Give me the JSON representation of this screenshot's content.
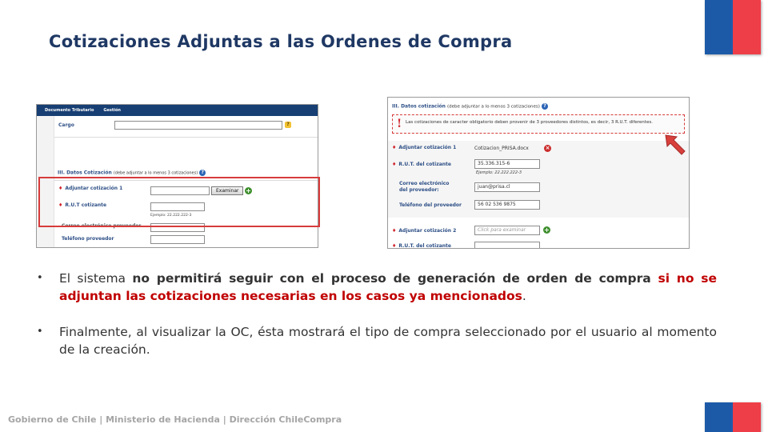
{
  "slide": {
    "title": "Cotizaciones Adjuntas a las Ordenes de Compra",
    "footer": "Gobierno de Chile | Ministerio de Hacienda | Dirección ChileCompra",
    "colors": {
      "title": "#1f3864",
      "flag_blue": "#1c5aa8",
      "flag_red": "#ee3e48",
      "emphasis": "#c00000"
    }
  },
  "screenshot_left": {
    "nav": [
      "Documento Tributario",
      "Gestión"
    ],
    "cargo_label": "Cargo",
    "section_title": "III. Datos Cotización",
    "section_note": "(debe adjuntar a lo menos 3 cotizaciones)",
    "adjuntar_label": "Adjuntar cotización 1",
    "examinar_button": "Examinar",
    "rut_label": "R.U.T cotizante",
    "rut_hint": "Ejemplo: 22.222.222-3",
    "correo_label": "Correo electrónico proveedor",
    "telefono_label": "Teléfono proveedor"
  },
  "screenshot_right": {
    "section_title": "III. Datos cotización",
    "section_note": "(debe adjuntar a lo menos 3 cotizaciones)",
    "warning": "Las cotizaciones de caracter obligatorio deben provenir de 3 proveedores distintos, es decir, 3 R.U.T. diferentes.",
    "adjuntar1_label": "Adjuntar cotización 1",
    "file_name": "Cotizacion_PRISA.docx",
    "rut_label": "R.U.T. del cotizante",
    "rut_value": "35.336.315-6",
    "rut_hint": "Ejemplo: 22.222.222-3",
    "correo_label_1": "Correo electrónico",
    "correo_label_2": "del proveedor:",
    "correo_value": "juan@prisa.cl",
    "telefono_label": "Teléfono del proveedor",
    "telefono_value": "56 02 536 9875",
    "adjuntar2_label": "Adjuntar cotización 2",
    "adjuntar2_placeholder": "Click para examinar",
    "rut2_label": "R.U.T. del cotizante"
  },
  "bullets": {
    "b1_p1": "El sistema ",
    "b1_p2": "no permitirá seguir con el proceso de generación de orden de compra ",
    "b1_p3": "si no se adjuntan las cotizaciones necesarias en los casos ya mencionados",
    "b1_p4": ".",
    "b2": "Finalmente, al visualizar la OC, ésta mostrará el tipo de compra seleccionado por el usuario al momento de la creación."
  }
}
